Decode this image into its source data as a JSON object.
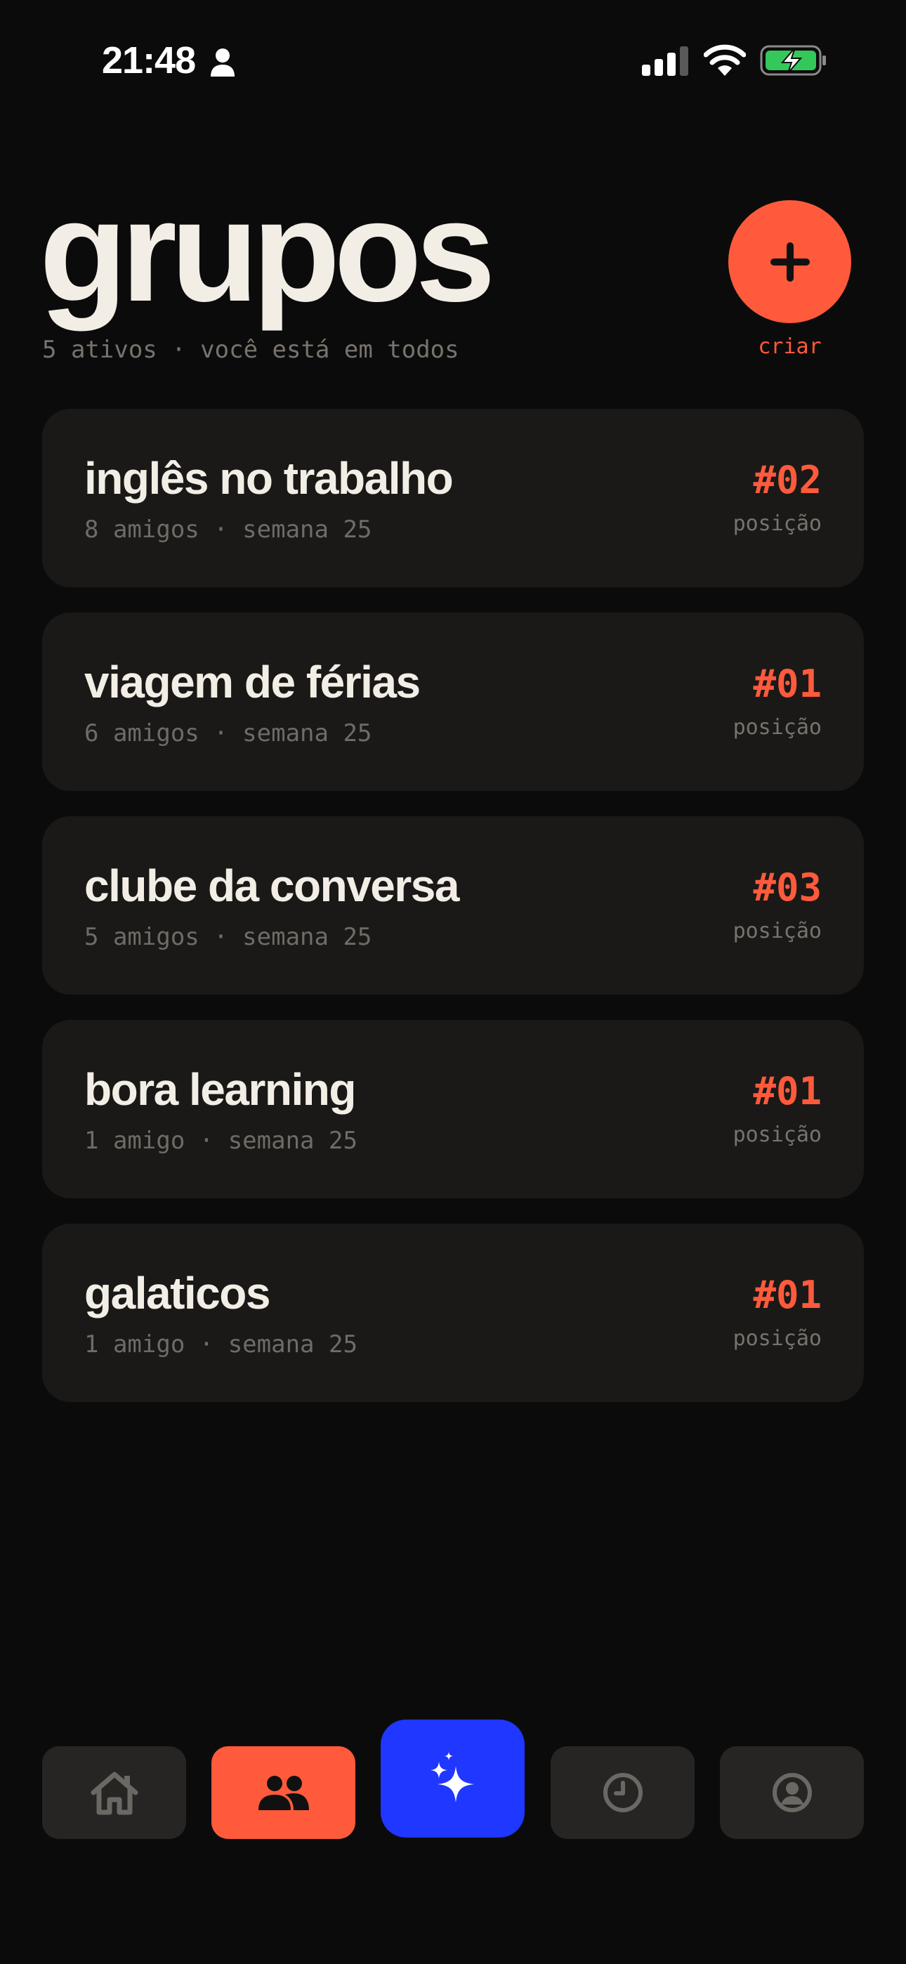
{
  "status_bar": {
    "time": "21:48",
    "icons": [
      "person-icon",
      "signal-icon",
      "wifi-icon",
      "battery-charging-icon"
    ],
    "battery_color": "#34c759"
  },
  "header": {
    "title": "grupos",
    "subtitle": "5 ativos · você está em todos",
    "create_label": "criar",
    "create_icon": "plus-icon"
  },
  "groups": [
    {
      "name": "inglês no trabalho",
      "meta": "8 amigos · semana 25",
      "rank": "#02",
      "rank_label": "posição"
    },
    {
      "name": "viagem de férias",
      "meta": "6 amigos · semana 25",
      "rank": "#01",
      "rank_label": "posição"
    },
    {
      "name": "clube da conversa",
      "meta": "5 amigos · semana 25",
      "rank": "#03",
      "rank_label": "posição"
    },
    {
      "name": "bora learning",
      "meta": "1 amigo · semana 25",
      "rank": "#01",
      "rank_label": "posição"
    },
    {
      "name": "galaticos",
      "meta": "1 amigo · semana 25",
      "rank": "#01",
      "rank_label": "posição"
    }
  ],
  "bottom_nav": {
    "items": [
      {
        "id": "home",
        "icon": "home-icon",
        "active": false
      },
      {
        "id": "groups",
        "icon": "groups-icon",
        "active": true
      },
      {
        "id": "ai",
        "icon": "sparkles-icon",
        "active": false
      },
      {
        "id": "history",
        "icon": "clock-icon",
        "active": false
      },
      {
        "id": "profile",
        "icon": "profile-icon",
        "active": false
      }
    ]
  },
  "colors": {
    "background": "#0c0b0b",
    "card": "#1a1917",
    "accent": "#ff5a3c",
    "ai_button": "#1f37ff",
    "text_primary": "#f2eee6",
    "text_muted": "#77736d"
  }
}
